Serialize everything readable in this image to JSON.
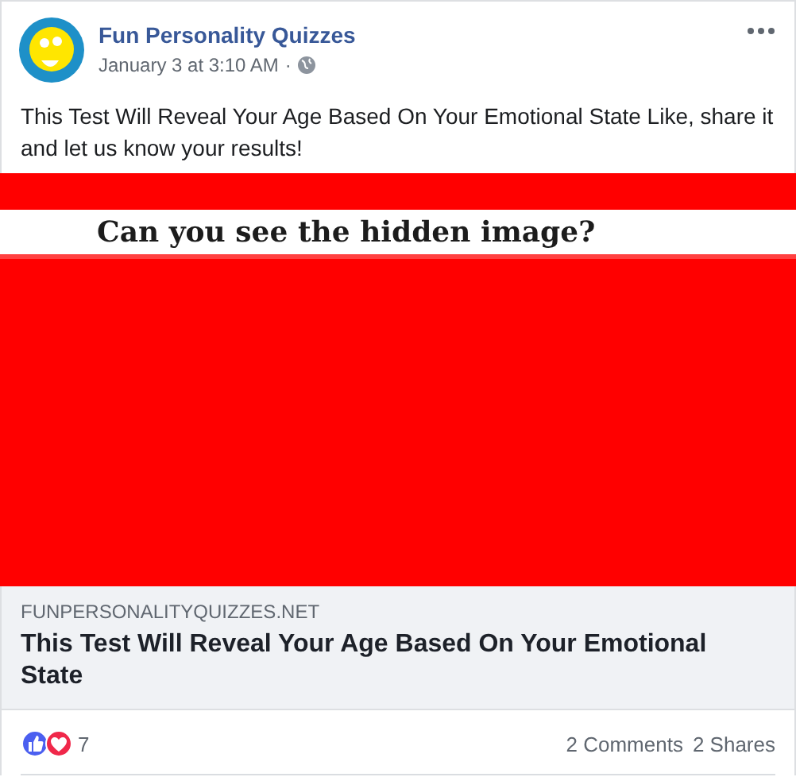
{
  "post": {
    "page_name": "Fun Personality Quizzes",
    "timestamp": "January 3 at 3:10 AM",
    "separator": "·",
    "text": "This Test Will Reveal Your Age Based On Your Emotional State Like, share it and let us know your results!"
  },
  "link_preview": {
    "image_caption": "Can you see the hidden image?",
    "domain": "FUNPERSONALITYQUIZZES.NET",
    "title": "This Test Will Reveal Your Age Based On Your Emotional State"
  },
  "footer": {
    "reactions": [
      {
        "kind": "like",
        "color": "#4b5ff0"
      },
      {
        "kind": "love",
        "color": "#f0284a"
      }
    ],
    "reaction_count": "7",
    "comments": "2 Comments",
    "shares": "2 Shares"
  }
}
